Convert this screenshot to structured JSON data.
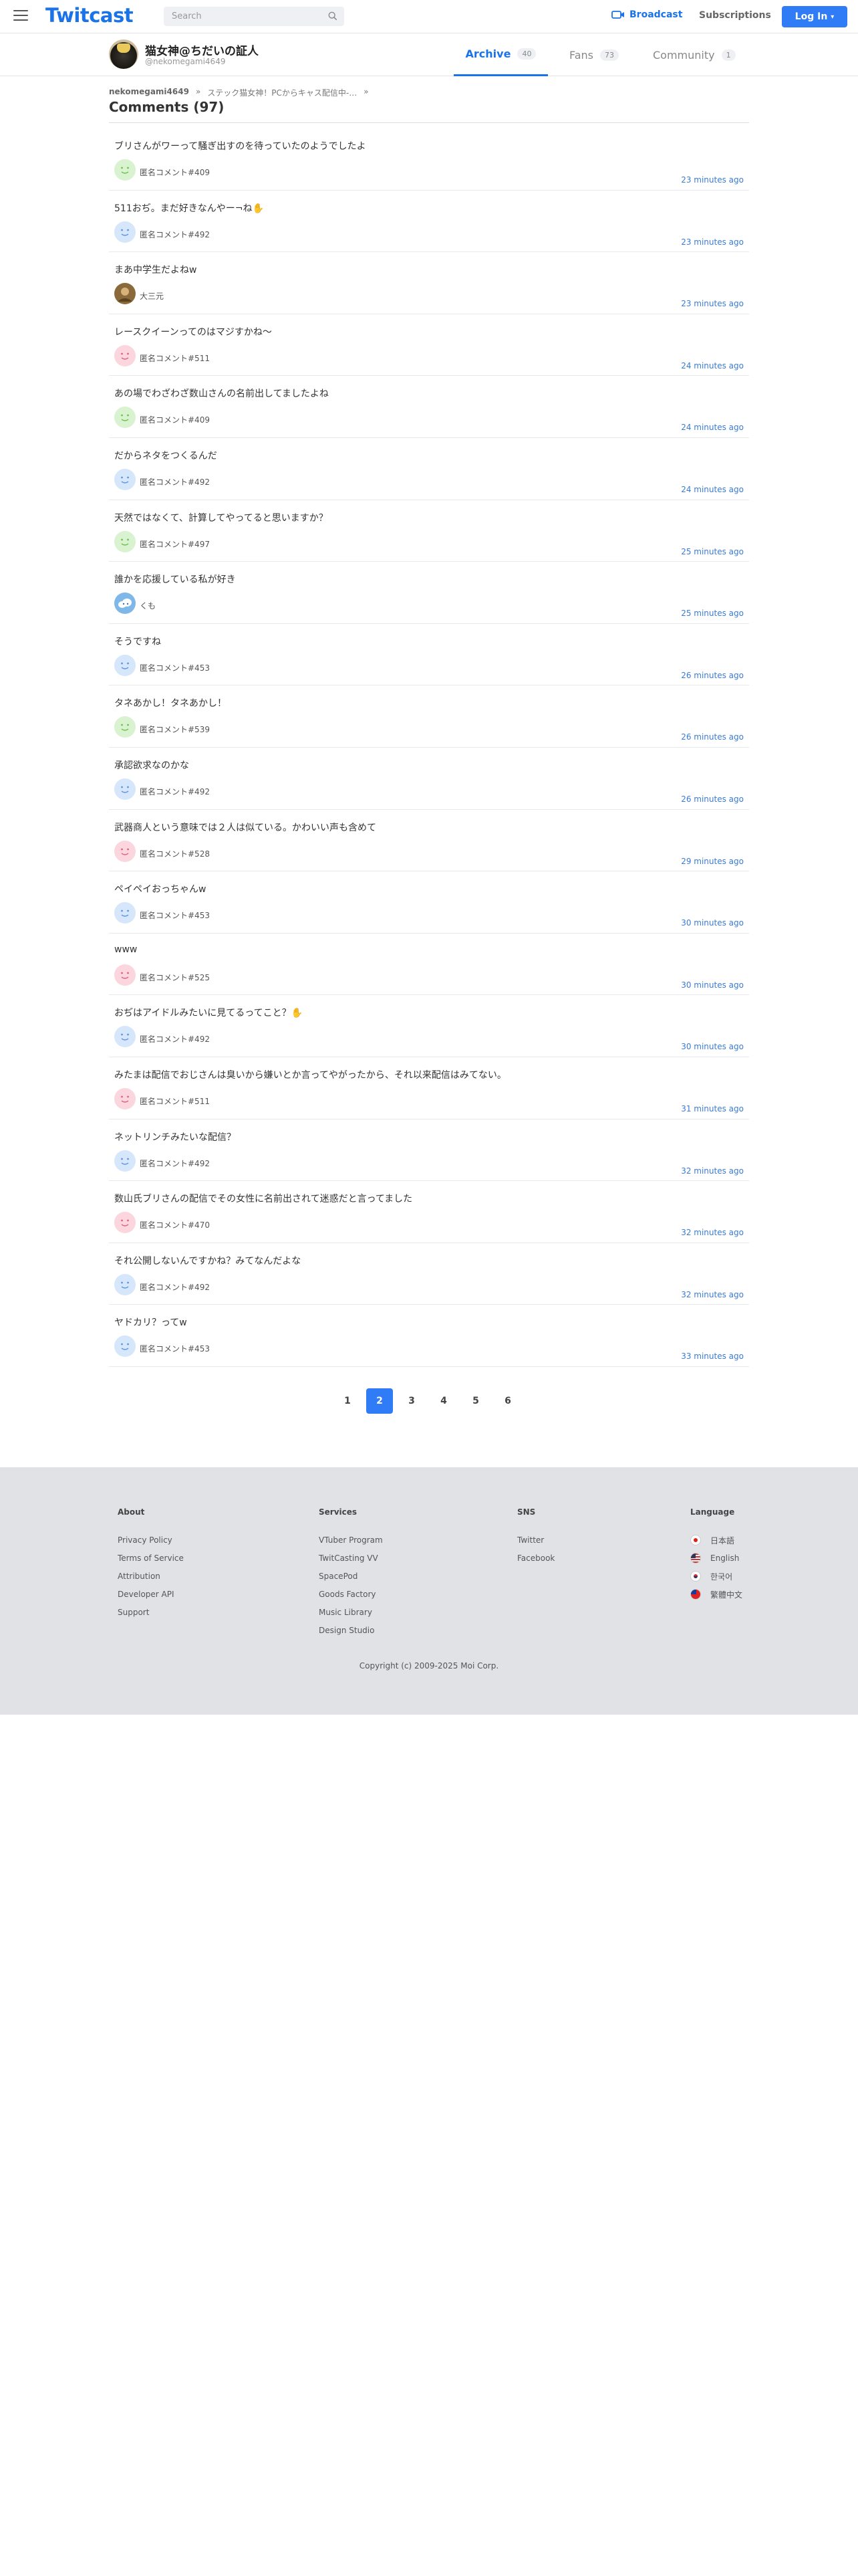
{
  "header": {
    "logo": "Twitcast",
    "search_placeholder": "Search",
    "broadcast": "Broadcast",
    "subscriptions": "Subscriptions",
    "login": "Log In"
  },
  "profile": {
    "name": "猫女神@ちだいの証人",
    "id": "@nekomegami4649",
    "tabs": [
      {
        "label": "Archive",
        "count": "40"
      },
      {
        "label": "Fans",
        "count": "73"
      },
      {
        "label": "Community",
        "count": "1"
      }
    ]
  },
  "breadcrumb": {
    "user": "nekomegami4649",
    "sep1": "»",
    "live": "ステック猫女神！PCからキャス配信中-…",
    "sep2": "»"
  },
  "page_title": "Comments (97)",
  "comments": [
    {
      "text": "ブリさんがワーって騒ぎ出すのを待っていたのようでしたよ",
      "user": "匿名コメント#409",
      "time": "23 minutes ago",
      "avatar": "green"
    },
    {
      "text": "511おぢ。まだ好きなんやー¬ね✋",
      "user": "匿名コメント#492",
      "time": "23 minutes ago",
      "avatar": "blue"
    },
    {
      "text": "まあ中学生だよねw",
      "user": "大三元",
      "time": "23 minutes ago",
      "avatar": "photo"
    },
    {
      "text": "レースクイーンってのはマジすかね〜",
      "user": "匿名コメント#511",
      "time": "24 minutes ago",
      "avatar": "pink"
    },
    {
      "text": "あの場でわざわざ数山さんの名前出してましたよね",
      "user": "匿名コメント#409",
      "time": "24 minutes ago",
      "avatar": "green"
    },
    {
      "text": "だからネタをつくるんだ",
      "user": "匿名コメント#492",
      "time": "24 minutes ago",
      "avatar": "blue"
    },
    {
      "text": "天然ではなくて、計算してやってると思いますか？",
      "user": "匿名コメント#497",
      "time": "25 minutes ago",
      "avatar": "green"
    },
    {
      "text": "誰かを応援している私が好き",
      "user": "くも",
      "time": "25 minutes ago",
      "avatar": "cloud"
    },
    {
      "text": "そうですね",
      "user": "匿名コメント#453",
      "time": "26 minutes ago",
      "avatar": "blue"
    },
    {
      "text": "タネあかし！タネあかし！",
      "user": "匿名コメント#539",
      "time": "26 minutes ago",
      "avatar": "green"
    },
    {
      "text": "承認欲求なのかな",
      "user": "匿名コメント#492",
      "time": "26 minutes ago",
      "avatar": "blue"
    },
    {
      "text": "武器商人という意味では２人は似ている。かわいい声も含めて",
      "user": "匿名コメント#528",
      "time": "29 minutes ago",
      "avatar": "pink"
    },
    {
      "text": "ペイペイおっちゃんw",
      "user": "匿名コメント#453",
      "time": "30 minutes ago",
      "avatar": "blue"
    },
    {
      "text": "www",
      "user": "匿名コメント#525",
      "time": "30 minutes ago",
      "avatar": "pink"
    },
    {
      "text": "おぢはアイドルみたいに見てるってこと？✋",
      "user": "匿名コメント#492",
      "time": "30 minutes ago",
      "avatar": "blue"
    },
    {
      "text": "みたまは配信でおじさんは臭いから嫌いとか言ってやがったから、それ以来配信はみてない。",
      "user": "匿名コメント#511",
      "time": "31 minutes ago",
      "avatar": "pink"
    },
    {
      "text": "ネットリンチみたいな配信？",
      "user": "匿名コメント#492",
      "time": "32 minutes ago",
      "avatar": "blue"
    },
    {
      "text": "数山氏ブリさんの配信でその女性に名前出されて迷惑だと言ってました",
      "user": "匿名コメント#470",
      "time": "32 minutes ago",
      "avatar": "pink"
    },
    {
      "text": "それ公開しないんですかね？みてなんだよな",
      "user": "匿名コメント#492",
      "time": "32 minutes ago",
      "avatar": "blue"
    },
    {
      "text": "ヤドカリ？ってw",
      "user": "匿名コメント#453",
      "time": "33 minutes ago",
      "avatar": "blue"
    }
  ],
  "pagination": [
    "1",
    "2",
    "3",
    "4",
    "5",
    "6"
  ],
  "pagination_active": "2",
  "footer": {
    "about": {
      "heading": "About",
      "links": [
        "Privacy Policy",
        "Terms of Service",
        "Attribution",
        "Developer API",
        "Support"
      ]
    },
    "services": {
      "heading": "Services",
      "links": [
        "VTuber Program",
        "TwitCasting VV",
        "SpacePod",
        "Goods Factory",
        "Music Library",
        "Design Studio"
      ]
    },
    "sns": {
      "heading": "SNS",
      "links": [
        "Twitter",
        "Facebook"
      ]
    },
    "language": {
      "heading": "Language",
      "links": [
        "日本語",
        "English",
        "한국어",
        "繁體中文"
      ]
    },
    "copyright": "Copyright (c) 2009-2025 Moi Corp."
  },
  "colors": {
    "accent": "#2f7cf6",
    "link": "#1a73e8",
    "footer_bg": "#e0e2e6"
  }
}
